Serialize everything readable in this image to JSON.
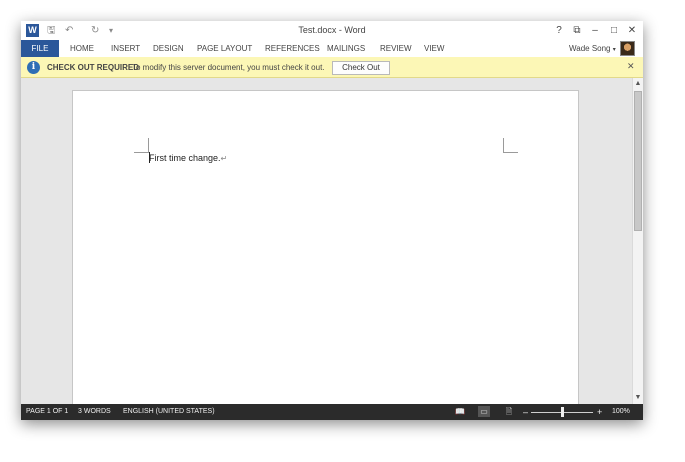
{
  "titlebar": {
    "app_icon": "word-logo-icon",
    "app_icon_letter": "W",
    "title": "Test.docx - Word",
    "help": "?",
    "ribbon_display": "⧉",
    "minimize": "–",
    "maximize": "□",
    "close": "✕",
    "qat": {
      "save": "🖫",
      "undo": "↶",
      "redo": "↻",
      "customize": "▾"
    }
  },
  "ribbon": {
    "tabs": [
      {
        "label": "FILE"
      },
      {
        "label": "HOME"
      },
      {
        "label": "INSERT"
      },
      {
        "label": "DESIGN"
      },
      {
        "label": "PAGE LAYOUT"
      },
      {
        "label": "REFERENCES"
      },
      {
        "label": "MAILINGS"
      },
      {
        "label": "REVIEW"
      },
      {
        "label": "VIEW"
      }
    ],
    "user": "Wade Song",
    "user_dropdown": "▾"
  },
  "message_bar": {
    "title": "CHECK OUT REQUIRED",
    "text": "To modify this server document, you must check it out.",
    "button": "Check Out",
    "close": "✕",
    "icon_glyph": "i",
    "accent": "#fcf7b6"
  },
  "document": {
    "text": "First time change.",
    "paragraph_mark": "↵"
  },
  "scrollbar": {
    "up": "▲",
    "down": "▼"
  },
  "statusbar": {
    "page": "PAGE 1 OF 1",
    "words": "3 WORDS",
    "language": "ENGLISH (UNITED STATES)",
    "views": {
      "read": "📖",
      "print": "▭",
      "web": "🗎"
    },
    "zoom_out": "–",
    "zoom_in": "+",
    "zoom": "100%"
  },
  "colors": {
    "brand": "#2b579a",
    "status_bg": "#2b2b2b"
  }
}
